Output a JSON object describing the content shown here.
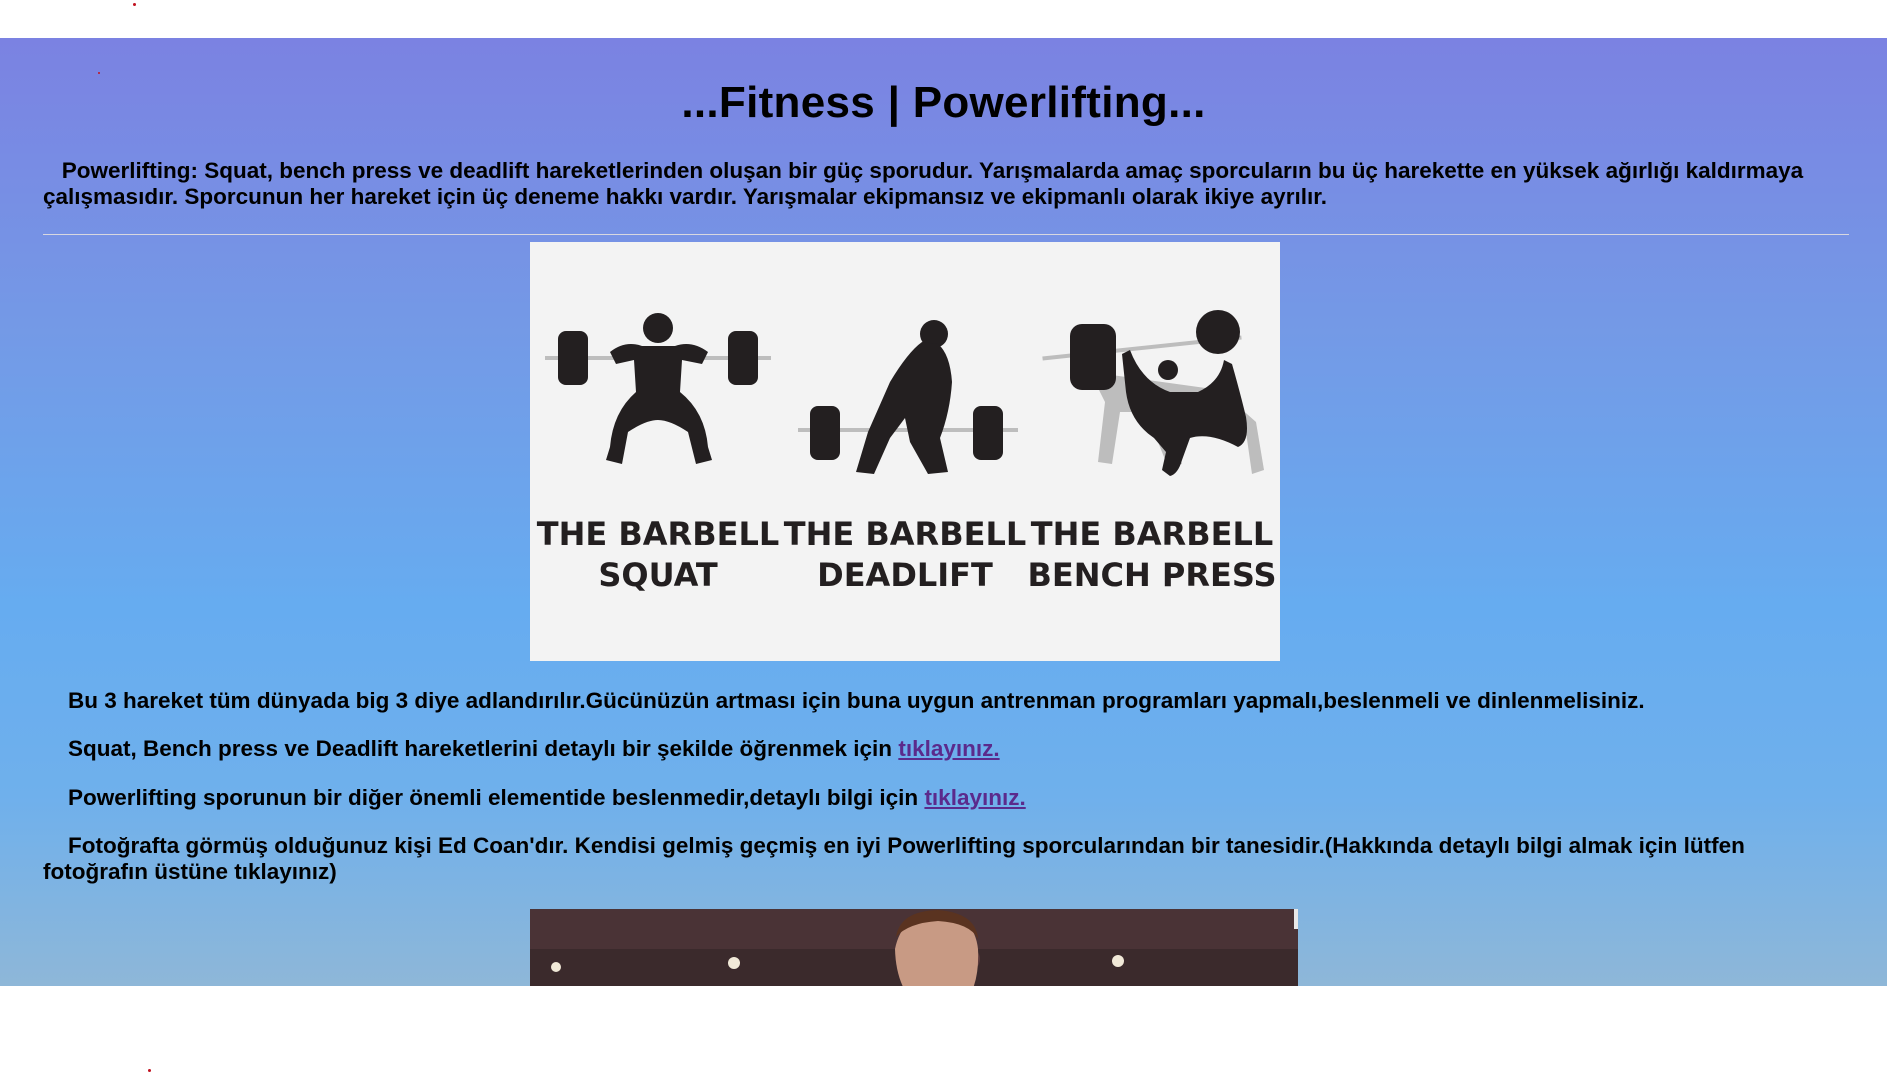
{
  "page": {
    "title": "...Fitness | Powerlifting...",
    "intro": "Powerlifting: Squat, bench press ve deadlift hareketlerinden oluşan bir güç sporudur. Yarışmalarda amaç sporcuların bu üç harekette en yüksek ağırlığı kaldırmaya çalışmasıdır. Sporcunun her hareket için üç deneme hakkı vardır. Yarışmalar ekipmansız ve ekipmanlı olarak ikiye ayrılır."
  },
  "lifts_image": {
    "captions": [
      {
        "line1": "THE BARBELL",
        "line2": "SQUAT"
      },
      {
        "line1": "THE BARBELL",
        "line2": "DEADLIFT"
      },
      {
        "line1": "THE BARBELL",
        "line2": "BENCH PRESS"
      }
    ]
  },
  "paragraphs": {
    "p1": "Bu 3 hareket tüm dünyada big 3 diye adlandırılır.Gücünüzün artması için buna uygun antrenman programları yapmalı,beslenmeli ve dinlenmelisiniz.",
    "p2_text": "Squat, Bench press ve Deadlift hareketlerini detaylı bir şekilde öğrenmek için",
    "p2_link": "tıklayınız.",
    "p3_text": "Powerlifting sporunun bir diğer önemli elementide beslenmedir,detaylı bilgi için",
    "p3_link": "tıklayınız.",
    "p4": "Fotoğrafta görmüş olduğunuz kişi Ed Coan'dır. Kendisi gelmiş geçmiş en iyi Powerlifting sporcularından bir tanesidir.(Hakkında detaylı bilgi almak için lütfen fotoğrafın üstüne tıklayınız)"
  },
  "colors": {
    "gradient_top": "#7b82e2",
    "gradient_bottom": "#8eb7d8",
    "link": "#5b2a8c"
  }
}
